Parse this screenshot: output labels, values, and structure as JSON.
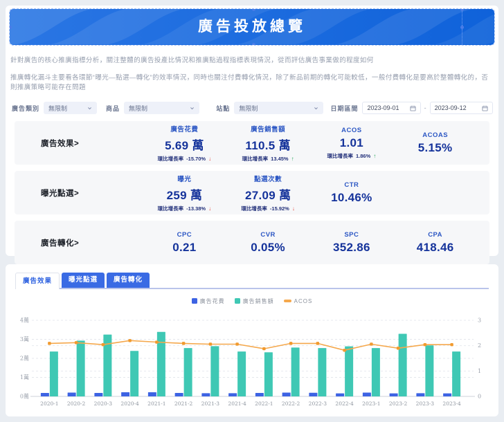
{
  "banner": {
    "title": "廣告投放總覽"
  },
  "descriptions": [
    "針對廣告的核心推廣指標分析，關注整體的廣告投產比情況和推廣點過程指標表現情況，從而評估廣告事業做的程度如何",
    "推廣轉化漏斗主要看各環節“曝光—點選—轉化”的效率情況，同時也關注付費轉化情況，除了新品前期的轉化可能較低，一般付費轉化是要高於整體轉化的，否則推廣策略可能存在問題"
  ],
  "filters": {
    "category_label": "廣告類別",
    "category_value": "無限制",
    "product_label": "商品",
    "product_value": "無限制",
    "site_label": "站點",
    "site_value": "無限制",
    "date_label": "日期區間",
    "date_start": "2023-09-01",
    "date_separator": "-",
    "date_end": "2023-09-12"
  },
  "metrics": {
    "growth_label": "環比增長率",
    "rows": [
      {
        "label": "廣告效果>",
        "items": [
          {
            "name": "廣告花費",
            "value": "5.69 萬",
            "sub_value": "-15.70%",
            "trend": "down"
          },
          {
            "name": "廣告銷售額",
            "value": "110.5 萬",
            "sub_value": "13.45%",
            "trend": "up"
          },
          {
            "name": "ACOS",
            "value": "1.01",
            "sub_value": "1.86%",
            "trend": "up"
          },
          {
            "name": "ACOAS",
            "value": "5.15%"
          }
        ]
      },
      {
        "label": "曝光點選>",
        "items": [
          {
            "name": "曝光",
            "value": "259 萬",
            "sub_value": "-13.38%",
            "trend": "down"
          },
          {
            "name": "點選次數",
            "value": "27.09 萬",
            "sub_value": "-15.92%",
            "trend": "down"
          },
          {
            "name": "CTR",
            "value": "10.46%"
          },
          null
        ]
      },
      {
        "label": "廣告轉化>",
        "items": [
          {
            "name": "CPC",
            "value": "0.21"
          },
          {
            "name": "CVR",
            "value": "0.05%"
          },
          {
            "name": "SPC",
            "value": "352.86"
          },
          {
            "name": "CPA",
            "value": "418.46"
          }
        ]
      }
    ]
  },
  "tabs": [
    {
      "label": "廣告效果",
      "active": true
    },
    {
      "label": "曝光點選",
      "active": false
    },
    {
      "label": "廣告轉化",
      "active": false
    }
  ],
  "chart_data": {
    "type": "bar",
    "title": "",
    "categories": [
      "2020-1",
      "2020-2",
      "2020-3",
      "2020-4",
      "2021-1",
      "2021-2",
      "2021-3",
      "2021-4",
      "2022-1",
      "2022-2",
      "2022-3",
      "2022-4",
      "2023-1",
      "2023-2",
      "2023-3",
      "2023-4"
    ],
    "series": [
      {
        "name": "廣告花費",
        "type": "bar",
        "axis": "left",
        "color": "#3D63E3",
        "values": [
          0.18,
          0.2,
          0.18,
          0.22,
          0.22,
          0.18,
          0.17,
          0.17,
          0.18,
          0.2,
          0.19,
          0.16,
          0.2,
          0.16,
          0.17,
          0.16
        ]
      },
      {
        "name": "廣告銷售額",
        "type": "bar",
        "axis": "left",
        "color": "#3FC8B4",
        "values": [
          2.36,
          2.93,
          3.25,
          2.39,
          3.39,
          2.54,
          2.64,
          2.36,
          2.32,
          2.57,
          2.54,
          2.63,
          2.54,
          3.29,
          2.68,
          2.36
        ]
      },
      {
        "name": "ACOS",
        "type": "line",
        "axis": "right",
        "color": "#F5A84C",
        "values": [
          2.09,
          2.12,
          2.04,
          2.2,
          2.14,
          2.09,
          2.06,
          2.06,
          1.88,
          2.09,
          2.09,
          1.82,
          2.06,
          1.9,
          2.04,
          2.04
        ]
      }
    ],
    "left_axis": {
      "label_suffix": "萬",
      "ticks": [
        "0萬",
        "1萬",
        "2萬",
        "3萬",
        "4萬"
      ],
      "min": 0,
      "max": 4
    },
    "right_axis": {
      "ticks": [
        "0",
        "1",
        "2",
        "3"
      ],
      "min": 0,
      "max": 3
    },
    "grid": "dashed",
    "legend_position": "top-center"
  },
  "colors": {
    "accent_blue": "#3A6BE4",
    "value_navy": "#15339B",
    "bar_spend": "#3D63E3",
    "bar_sales": "#3FC8B4",
    "line_acos": "#F5A84C",
    "trend_up": "#23A457",
    "trend_down": "#E5483C"
  }
}
